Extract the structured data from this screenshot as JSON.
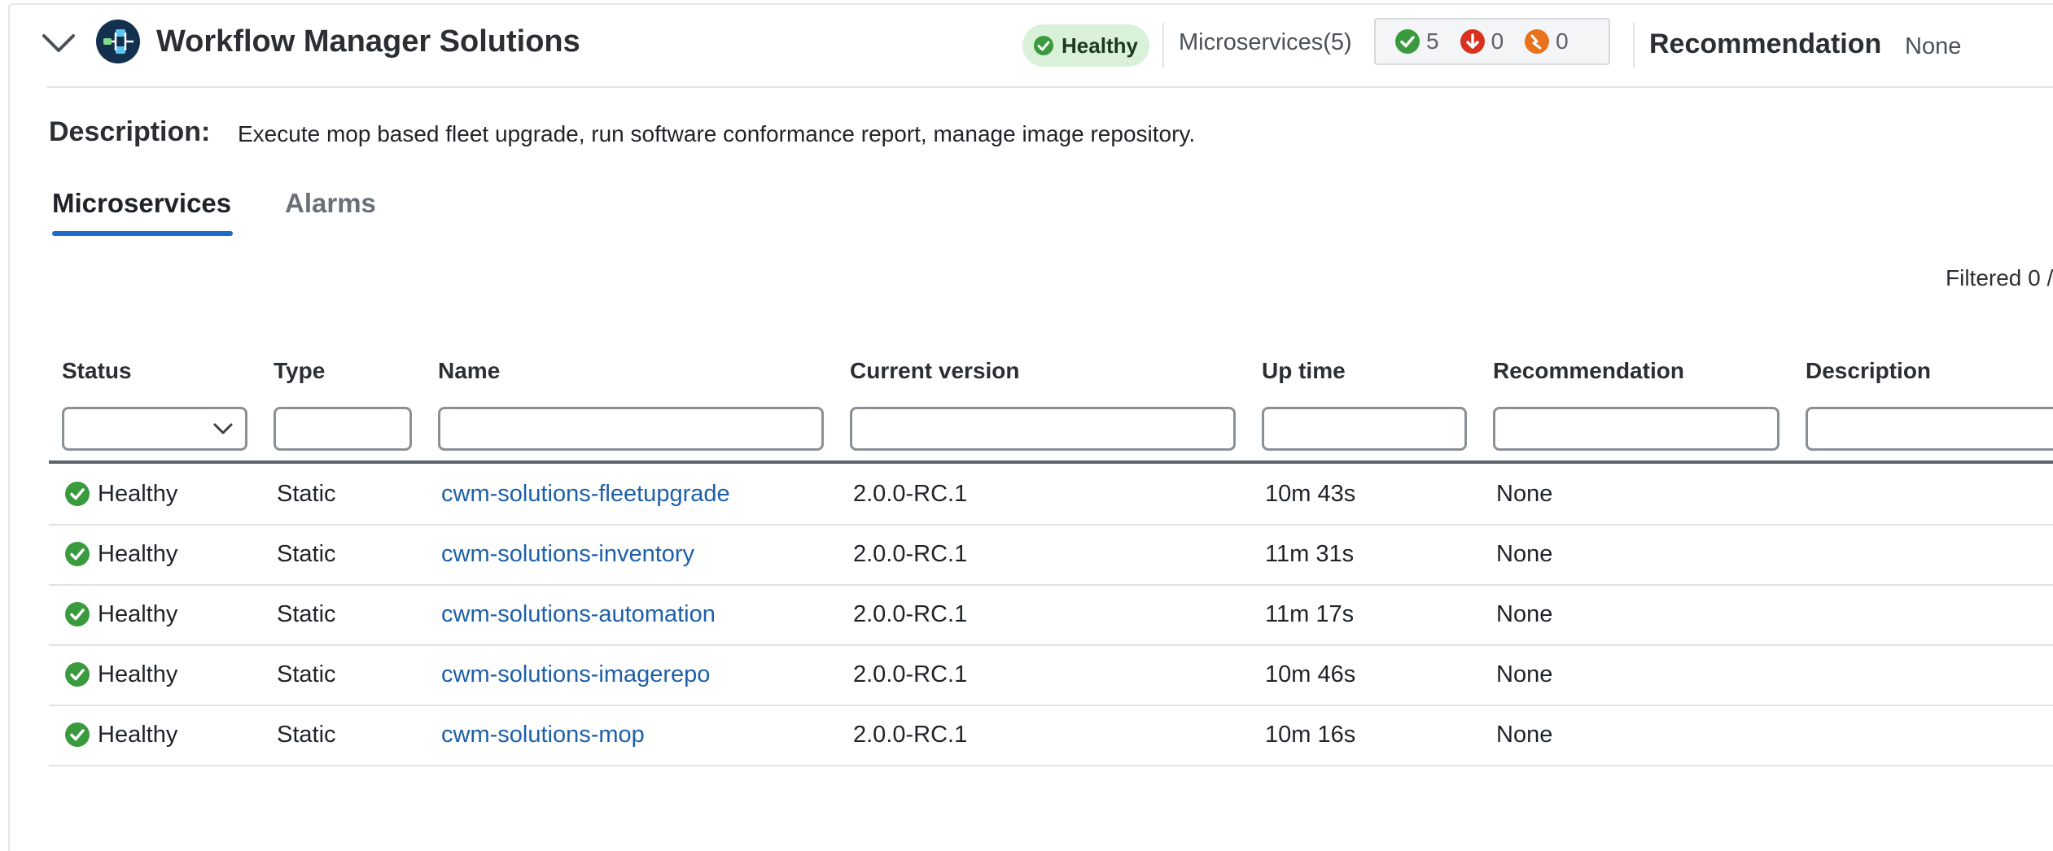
{
  "header": {
    "title": "Workflow Manager Solutions",
    "health_status": "Healthy",
    "microservices_label": "Microservices(5)",
    "counts": {
      "healthy": "5",
      "down": "0",
      "warning": "0"
    },
    "recommendation_label": "Recommendation",
    "recommendation_value": "None"
  },
  "description": {
    "label": "Description:",
    "text": "Execute mop based fleet upgrade, run software conformance report, manage image repository."
  },
  "tabs": [
    {
      "label": "Microservices",
      "active": true
    },
    {
      "label": "Alarms",
      "active": false
    }
  ],
  "filter_summary": "Filtered 0 /",
  "table": {
    "columns": [
      "Status",
      "Type",
      "Name",
      "Current version",
      "Up time",
      "Recommendation",
      "Description"
    ],
    "rows": [
      {
        "status": "Healthy",
        "type": "Static",
        "name": "cwm-solutions-fleetupgrade",
        "version": "2.0.0-RC.1",
        "uptime": "10m 43s",
        "recommendation": "None",
        "description": ""
      },
      {
        "status": "Healthy",
        "type": "Static",
        "name": "cwm-solutions-inventory",
        "version": "2.0.0-RC.1",
        "uptime": "11m 31s",
        "recommendation": "None",
        "description": ""
      },
      {
        "status": "Healthy",
        "type": "Static",
        "name": "cwm-solutions-automation",
        "version": "2.0.0-RC.1",
        "uptime": "11m 17s",
        "recommendation": "None",
        "description": ""
      },
      {
        "status": "Healthy",
        "type": "Static",
        "name": "cwm-solutions-imagerepo",
        "version": "2.0.0-RC.1",
        "uptime": "10m 46s",
        "recommendation": "None",
        "description": ""
      },
      {
        "status": "Healthy",
        "type": "Static",
        "name": "cwm-solutions-mop",
        "version": "2.0.0-RC.1",
        "uptime": "10m 16s",
        "recommendation": "None",
        "description": ""
      }
    ]
  },
  "colors": {
    "healthy": "#3a9a3e",
    "down": "#d8321f",
    "warning": "#e8731c",
    "link": "#1d5fa8",
    "tab_accent": "#1d69cc"
  },
  "icons": [
    "chevron-down-icon",
    "app-logo-icon",
    "check-circle-icon",
    "arrow-down-circle-icon",
    "warning-circle-icon",
    "select-chevron-icon"
  ]
}
